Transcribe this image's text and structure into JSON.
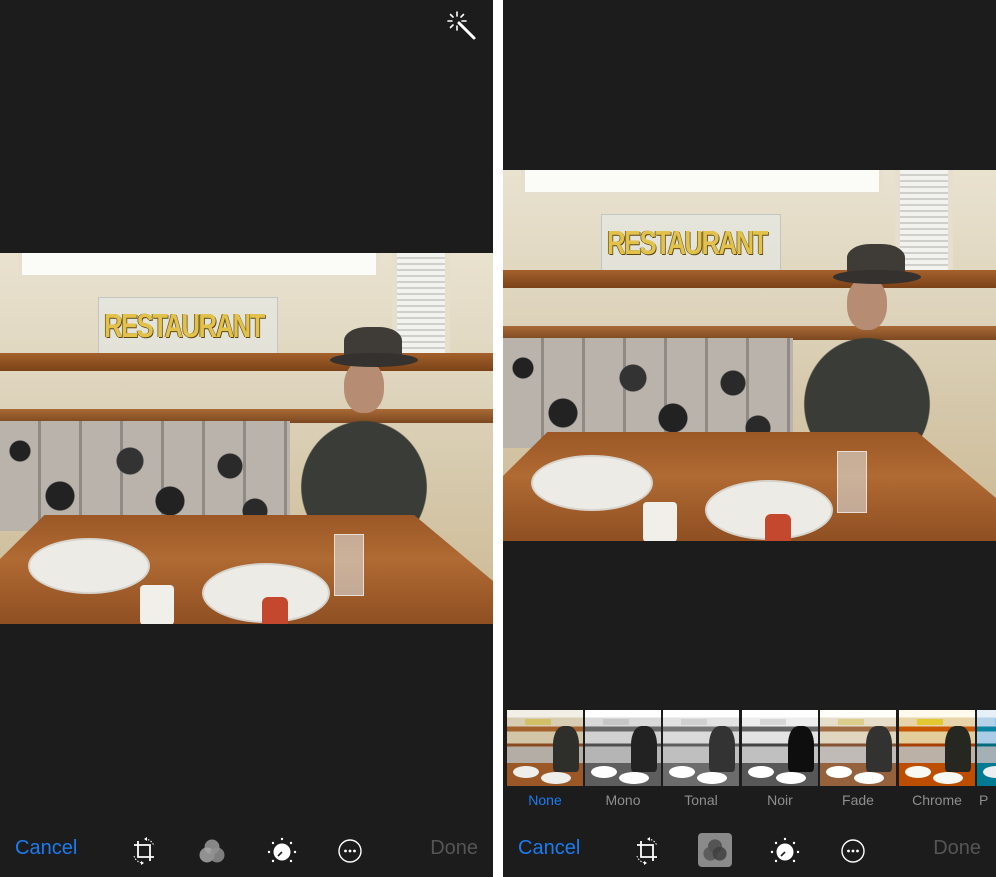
{
  "screens": {
    "left": {
      "mode": "auto-enhance view",
      "photo_alt": "Man in a fedora seated at a restaurant booth beneath a RESTAURANT sign",
      "photo_sign_text": "RESTAURANT",
      "toolbar": {
        "cancel_label": "Cancel",
        "done_label": "Done",
        "icons": [
          "crop-rotate-icon",
          "filters-icon",
          "adjust-dial-icon",
          "more-options-icon"
        ],
        "active_tool": null
      },
      "top_icon": "magic-wand-icon"
    },
    "right": {
      "mode": "filters view",
      "photo_alt": "Man in a fedora seated at a restaurant booth beneath a RESTAURANT sign",
      "photo_sign_text": "RESTAURANT",
      "filters": [
        {
          "label": "None",
          "selected": true
        },
        {
          "label": "Mono",
          "selected": false
        },
        {
          "label": "Tonal",
          "selected": false
        },
        {
          "label": "Noir",
          "selected": false
        },
        {
          "label": "Fade",
          "selected": false
        },
        {
          "label": "Chrome",
          "selected": false
        },
        {
          "label": "P",
          "selected": false
        }
      ],
      "toolbar": {
        "cancel_label": "Cancel",
        "done_label": "Done",
        "icons": [
          "crop-rotate-icon",
          "filters-icon",
          "adjust-dial-icon",
          "more-options-icon"
        ],
        "active_tool": "filters"
      }
    }
  },
  "colors": {
    "accent": "#1a7cf0",
    "background": "#1c1c1c",
    "done_disabled": "#555555",
    "filter_label": "#8e8e8e",
    "divider": "#ffffff"
  }
}
